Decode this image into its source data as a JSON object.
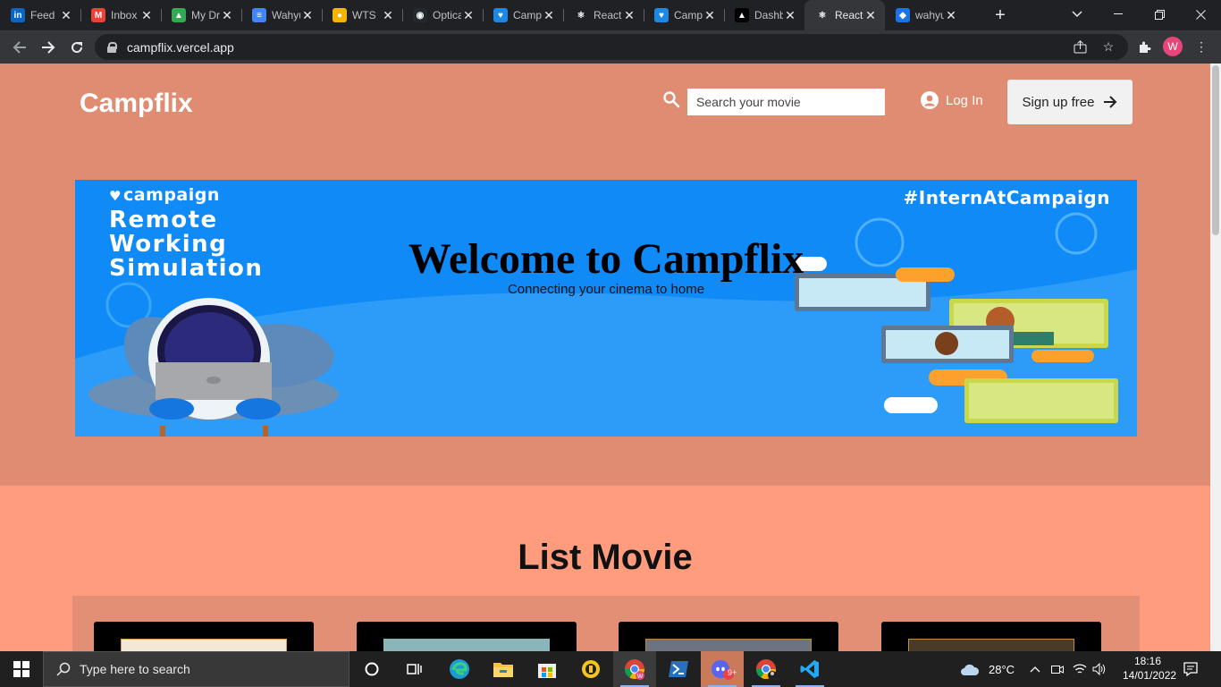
{
  "browser": {
    "tabs": [
      {
        "title": "Feed",
        "icon": "linkedin-icon",
        "color": "#0a66c2",
        "glyph": "in"
      },
      {
        "title": "Inbox",
        "icon": "gmail-icon",
        "color": "#ea4335",
        "glyph": "M"
      },
      {
        "title": "My Drive",
        "icon": "drive-icon",
        "color": "#34a853",
        "glyph": "▲"
      },
      {
        "title": "Wahyu",
        "icon": "docs-icon",
        "color": "#4285f4",
        "glyph": "≡"
      },
      {
        "title": "WTS",
        "icon": "emoji-icon",
        "color": "#f4b400",
        "glyph": "●"
      },
      {
        "title": "Optical",
        "icon": "github-icon",
        "color": "#24292f",
        "glyph": "◉"
      },
      {
        "title": "Campaign",
        "icon": "heart-icon",
        "color": "#1e88e5",
        "glyph": "♥"
      },
      {
        "title": "React App",
        "icon": "react-icon",
        "color": "#202124",
        "glyph": "⚛"
      },
      {
        "title": "Campaign",
        "icon": "heart-icon",
        "color": "#1e88e5",
        "glyph": "♥"
      },
      {
        "title": "Dashboard",
        "icon": "vercel-icon",
        "color": "#000000",
        "glyph": "▲"
      },
      {
        "title": "React App",
        "icon": "react-icon",
        "color": "#35363a",
        "glyph": "⚛",
        "active": true
      },
      {
        "title": "wahyu",
        "icon": "shield-icon",
        "color": "#1a73e8",
        "glyph": "◆"
      }
    ],
    "url": "campflix.vercel.app",
    "profile_initial": "W"
  },
  "page": {
    "brand": "Campflix",
    "search": {
      "placeholder": "Search your movie"
    },
    "login_label": "Log In",
    "signup_label": "Sign up free",
    "banner": {
      "brand": "campaign",
      "hashtag": "#InternAtCampaign",
      "program_line1": "Remote",
      "program_line2": "Working",
      "program_line3": "Simulation",
      "title": "Welcome to Campflix",
      "subtitle": "Connecting your cinema to home"
    },
    "section_title": "List Movie",
    "colors": {
      "hero_bg": "#e08c72",
      "page_bg": "#ff9c7e",
      "banner_bg": "#0f8af7"
    }
  },
  "taskbar": {
    "search_placeholder": "Type here to search",
    "weather": "28°C",
    "time": "18:16",
    "date": "14/01/2022",
    "discord_badge": "9+"
  }
}
